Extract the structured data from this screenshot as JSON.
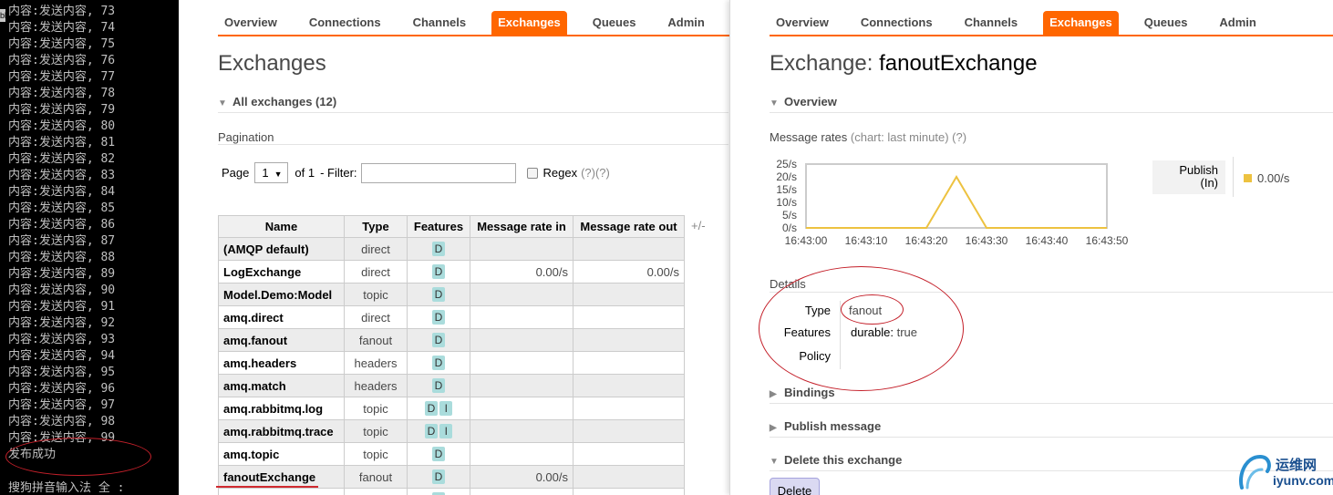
{
  "console": {
    "lines": [
      "内容:发送内容, 73",
      "内容:发送内容, 74",
      "内容:发送内容, 75",
      "内容:发送内容, 76",
      "内容:发送内容, 77",
      "内容:发送内容, 78",
      "内容:发送内容, 79",
      "内容:发送内容, 80",
      "内容:发送内容, 81",
      "内容:发送内容, 82",
      "内容:发送内容, 83",
      "内容:发送内容, 84",
      "内容:发送内容, 85",
      "内容:发送内容, 86",
      "内容:发送内容, 87",
      "内容:发送内容, 88",
      "内容:发送内容, 89",
      "内容:发送内容, 90",
      "内容:发送内容, 91",
      "内容:发送内容, 92",
      "内容:发送内容, 93",
      "内容:发送内容, 94",
      "内容:发送内容, 95",
      "内容:发送内容, 96",
      "内容:发送内容, 97",
      "内容:发送内容, 98",
      "内容:发送内容, 99",
      "发布成功"
    ],
    "ime_status": "搜狗拼音输入法 全 :",
    "edge_label": "bl"
  },
  "nav": {
    "tabs": [
      "Overview",
      "Connections",
      "Channels",
      "Exchanges",
      "Queues",
      "Admin"
    ],
    "active": "Exchanges"
  },
  "left": {
    "title": "Exchanges",
    "all_exchanges": "All exchanges (12)",
    "pagination": {
      "label": "Pagination",
      "page_label": "Page",
      "page_value": "1",
      "of_label": "of 1",
      "filter_label": "- Filter:",
      "regex_label": "Regex",
      "regex_help": "(?)(?)"
    },
    "table": {
      "headers": [
        "Name",
        "Type",
        "Features",
        "Message rate in",
        "Message rate out"
      ],
      "toggle": "+/-",
      "rows": [
        {
          "name": "(AMQP default)",
          "type": "direct",
          "features": [
            "D"
          ],
          "rate_in": "",
          "rate_out": ""
        },
        {
          "name": "LogExchange",
          "type": "direct",
          "features": [
            "D"
          ],
          "rate_in": "0.00/s",
          "rate_out": "0.00/s"
        },
        {
          "name": "Model.Demo:Model",
          "type": "topic",
          "features": [
            "D"
          ],
          "rate_in": "",
          "rate_out": ""
        },
        {
          "name": "amq.direct",
          "type": "direct",
          "features": [
            "D"
          ],
          "rate_in": "",
          "rate_out": ""
        },
        {
          "name": "amq.fanout",
          "type": "fanout",
          "features": [
            "D"
          ],
          "rate_in": "",
          "rate_out": ""
        },
        {
          "name": "amq.headers",
          "type": "headers",
          "features": [
            "D"
          ],
          "rate_in": "",
          "rate_out": ""
        },
        {
          "name": "amq.match",
          "type": "headers",
          "features": [
            "D"
          ],
          "rate_in": "",
          "rate_out": ""
        },
        {
          "name": "amq.rabbitmq.log",
          "type": "topic",
          "features": [
            "D",
            "I"
          ],
          "rate_in": "",
          "rate_out": ""
        },
        {
          "name": "amq.rabbitmq.trace",
          "type": "topic",
          "features": [
            "D",
            "I"
          ],
          "rate_in": "",
          "rate_out": ""
        },
        {
          "name": "amq.topic",
          "type": "topic",
          "features": [
            "D"
          ],
          "rate_in": "",
          "rate_out": ""
        },
        {
          "name": "fanoutExchange",
          "type": "fanout",
          "features": [
            "D"
          ],
          "rate_in": "0.00/s",
          "rate_out": ""
        },
        {
          "name": "",
          "type": "",
          "features": [
            "D"
          ],
          "rate_in": "",
          "rate_out": ""
        }
      ]
    }
  },
  "right": {
    "title_prefix": "Exchange:",
    "title_name": "fanoutExchange",
    "overview": "Overview",
    "rates_label": "Message rates",
    "rates_note": "(chart: last minute) (?)",
    "legend_label_1": "Publish",
    "legend_label_2": "(In)",
    "legend_value": "0.00/s",
    "details_label": "Details",
    "details": {
      "type_key": "Type",
      "type_val": "fanout",
      "features_key": "Features",
      "features_name": "durable:",
      "features_val": "true",
      "policy_key": "Policy"
    },
    "bindings": "Bindings",
    "publish_message": "Publish message",
    "delete_exchange": "Delete this exchange",
    "delete_button": "Delete"
  },
  "chart_data": {
    "type": "line",
    "x": [
      "16:43:00",
      "16:43:10",
      "16:43:20",
      "16:43:25",
      "16:43:30",
      "16:43:40",
      "16:43:50"
    ],
    "yticks": [
      "25/s",
      "20/s",
      "15/s",
      "10/s",
      "5/s",
      "0/s"
    ],
    "ylim": [
      0,
      25
    ],
    "points": [
      {
        "x": 0,
        "y": 0
      },
      {
        "x": 10,
        "y": 0
      },
      {
        "x": 20,
        "y": 0
      },
      {
        "x": 25,
        "y": 20
      },
      {
        "x": 30,
        "y": 0
      },
      {
        "x": 40,
        "y": 0
      },
      {
        "x": 50,
        "y": 0
      }
    ],
    "xticks": [
      "16:43:00",
      "16:43:10",
      "16:43:20",
      "16:43:30",
      "16:43:40",
      "16:43:50"
    ],
    "series": [
      {
        "name": "Publish (In)",
        "color": "#edc240"
      }
    ],
    "grid": false
  },
  "watermark": {
    "line1": "运维网",
    "line2": "iyunv.com"
  }
}
